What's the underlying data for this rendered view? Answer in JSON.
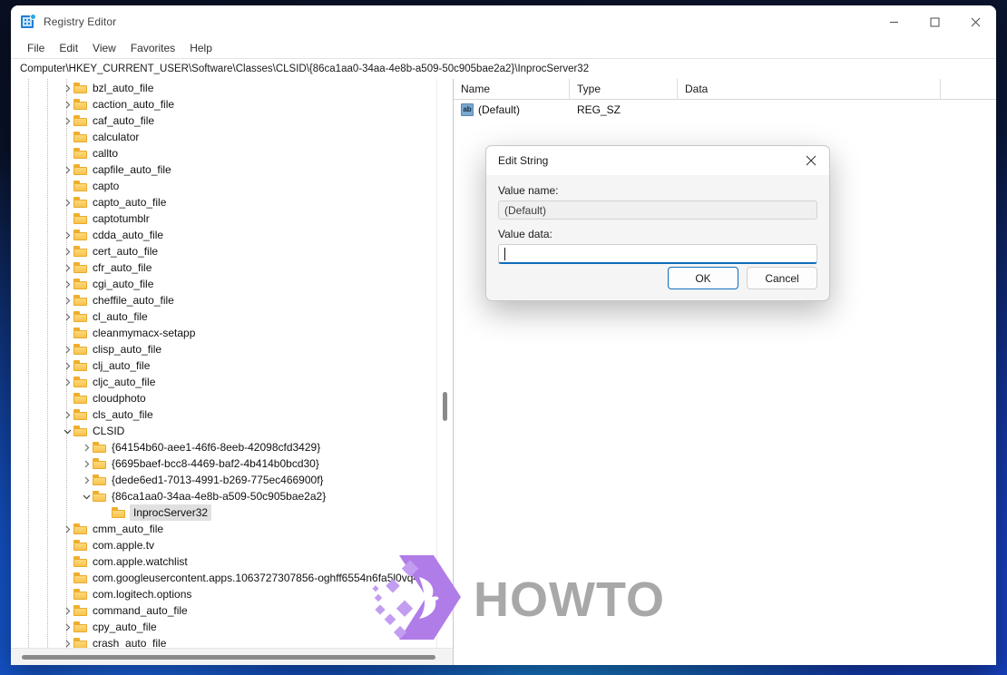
{
  "window": {
    "title": "Registry Editor",
    "icon": "registry-icon",
    "controls": {
      "minimize": "—",
      "maximize": "☐",
      "close": "✕"
    }
  },
  "menubar": {
    "items": [
      "File",
      "Edit",
      "View",
      "Favorites",
      "Help"
    ]
  },
  "addressbar": {
    "path": "Computer\\HKEY_CURRENT_USER\\Software\\Classes\\CLSID\\{86ca1aa0-34aa-4e8b-a509-50c905bae2a2}\\InprocServer32"
  },
  "tree": {
    "nodes": [
      {
        "label": "bzl_auto_file",
        "indent": 3,
        "twisty": "collapsed",
        "selected": false
      },
      {
        "label": "caction_auto_file",
        "indent": 3,
        "twisty": "collapsed",
        "selected": false
      },
      {
        "label": "caf_auto_file",
        "indent": 3,
        "twisty": "collapsed",
        "selected": false
      },
      {
        "label": "calculator",
        "indent": 3,
        "twisty": "none",
        "selected": false
      },
      {
        "label": "callto",
        "indent": 3,
        "twisty": "none",
        "selected": false
      },
      {
        "label": "capfile_auto_file",
        "indent": 3,
        "twisty": "collapsed",
        "selected": false
      },
      {
        "label": "capto",
        "indent": 3,
        "twisty": "none",
        "selected": false
      },
      {
        "label": "capto_auto_file",
        "indent": 3,
        "twisty": "collapsed",
        "selected": false
      },
      {
        "label": "captotumblr",
        "indent": 3,
        "twisty": "none",
        "selected": false
      },
      {
        "label": "cdda_auto_file",
        "indent": 3,
        "twisty": "collapsed",
        "selected": false
      },
      {
        "label": "cert_auto_file",
        "indent": 3,
        "twisty": "collapsed",
        "selected": false
      },
      {
        "label": "cfr_auto_file",
        "indent": 3,
        "twisty": "collapsed",
        "selected": false
      },
      {
        "label": "cgi_auto_file",
        "indent": 3,
        "twisty": "collapsed",
        "selected": false
      },
      {
        "label": "cheffile_auto_file",
        "indent": 3,
        "twisty": "collapsed",
        "selected": false
      },
      {
        "label": "cl_auto_file",
        "indent": 3,
        "twisty": "collapsed",
        "selected": false
      },
      {
        "label": "cleanmymacx-setapp",
        "indent": 3,
        "twisty": "none",
        "selected": false
      },
      {
        "label": "clisp_auto_file",
        "indent": 3,
        "twisty": "collapsed",
        "selected": false
      },
      {
        "label": "clj_auto_file",
        "indent": 3,
        "twisty": "collapsed",
        "selected": false
      },
      {
        "label": "cljc_auto_file",
        "indent": 3,
        "twisty": "collapsed",
        "selected": false
      },
      {
        "label": "cloudphoto",
        "indent": 3,
        "twisty": "none",
        "selected": false
      },
      {
        "label": "cls_auto_file",
        "indent": 3,
        "twisty": "collapsed",
        "selected": false
      },
      {
        "label": "CLSID",
        "indent": 3,
        "twisty": "expanded",
        "selected": false
      },
      {
        "label": "{64154b60-aee1-46f6-8eeb-42098cfd3429}",
        "indent": 4,
        "twisty": "collapsed",
        "selected": false
      },
      {
        "label": "{6695baef-bcc8-4469-baf2-4b414b0bcd30}",
        "indent": 4,
        "twisty": "collapsed",
        "selected": false
      },
      {
        "label": "{dede6ed1-7013-4991-b269-775ec466900f}",
        "indent": 4,
        "twisty": "collapsed",
        "selected": false
      },
      {
        "label": "{86ca1aa0-34aa-4e8b-a509-50c905bae2a2}",
        "indent": 4,
        "twisty": "expanded",
        "selected": false
      },
      {
        "label": "InprocServer32",
        "indent": 5,
        "twisty": "none",
        "selected": true
      },
      {
        "label": "cmm_auto_file",
        "indent": 3,
        "twisty": "collapsed",
        "selected": false
      },
      {
        "label": "com.apple.tv",
        "indent": 3,
        "twisty": "none",
        "selected": false
      },
      {
        "label": "com.apple.watchlist",
        "indent": 3,
        "twisty": "none",
        "selected": false
      },
      {
        "label": "com.googleusercontent.apps.1063727307856-oghff6554n6fa5l0vq4n2c",
        "indent": 3,
        "twisty": "none",
        "selected": false
      },
      {
        "label": "com.logitech.options",
        "indent": 3,
        "twisty": "none",
        "selected": false
      },
      {
        "label": "command_auto_file",
        "indent": 3,
        "twisty": "collapsed",
        "selected": false
      },
      {
        "label": "cpy_auto_file",
        "indent": 3,
        "twisty": "collapsed",
        "selected": false
      },
      {
        "label": "crash_auto_file",
        "indent": 3,
        "twisty": "collapsed",
        "selected": false
      }
    ]
  },
  "list": {
    "columns": [
      "Name",
      "Type",
      "Data"
    ],
    "rows": [
      {
        "icon": "string-value-icon",
        "name": "(Default)",
        "type": "REG_SZ",
        "data": ""
      }
    ]
  },
  "dialog": {
    "title": "Edit String",
    "close_icon": "close-icon",
    "value_name_label": "Value name:",
    "value_name": "(Default)",
    "value_data_label": "Value data:",
    "value_data": "",
    "ok_label": "OK",
    "cancel_label": "Cancel"
  },
  "watermark": {
    "text": "HOWTO"
  },
  "colors": {
    "accent": "#0f6cbd",
    "folder": "#f5bb3c",
    "selection": "#e0e0e0",
    "watermark": "#a8a8a8",
    "logo_purple": "#b07ce8"
  }
}
